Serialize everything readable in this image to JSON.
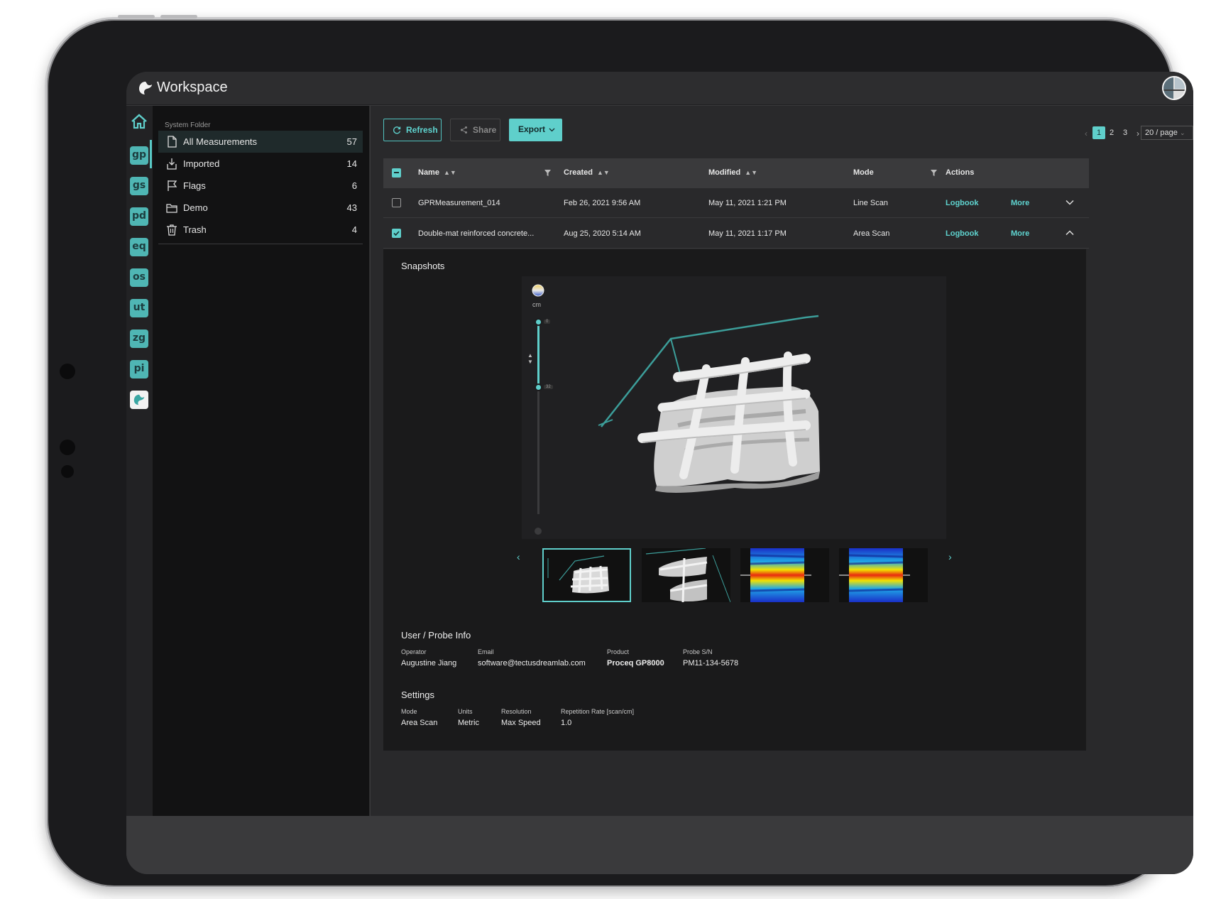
{
  "app": {
    "title": "Workspace"
  },
  "rail": {
    "apps": [
      {
        "id": "gp",
        "label": "gp"
      },
      {
        "id": "gs",
        "label": "gs"
      },
      {
        "id": "pd",
        "label": "pd"
      },
      {
        "id": "eq",
        "label": "eq"
      },
      {
        "id": "os",
        "label": "os"
      },
      {
        "id": "ut",
        "label": "ut"
      },
      {
        "id": "zg",
        "label": "zg"
      },
      {
        "id": "pi",
        "label": "pi"
      }
    ]
  },
  "folders": {
    "caption": "System Folder",
    "items": [
      {
        "label": "All Measurements",
        "count": "57",
        "icon": "document-icon",
        "active": true
      },
      {
        "label": "Imported",
        "count": "14",
        "icon": "import-icon"
      },
      {
        "label": "Flags",
        "count": "6",
        "icon": "flag-icon"
      },
      {
        "label": "Demo",
        "count": "43",
        "icon": "folder-icon"
      },
      {
        "label": "Trash",
        "count": "4",
        "icon": "trash-icon"
      }
    ]
  },
  "toolbar": {
    "refresh": "Refresh",
    "share": "Share",
    "export": "Export"
  },
  "pagination": {
    "pages": [
      "1",
      "2",
      "3"
    ],
    "current": "1",
    "page_size": "20 / page"
  },
  "table": {
    "columns": {
      "name": "Name",
      "created": "Created",
      "modified": "Modified",
      "mode": "Mode",
      "actions": "Actions"
    },
    "rows": [
      {
        "name": "GPRMeasurement_014",
        "created": "Feb 26, 2021 9:56 AM",
        "modified": "May 11, 2021 1:21 PM",
        "mode": "Line Scan",
        "logbook": "Logbook",
        "more": "More",
        "checked": false,
        "expanded": false
      },
      {
        "name": "Double-mat reinforced concrete...",
        "created": "Aug 25, 2020 5:14 AM",
        "modified": "May 11, 2021 1:17 PM",
        "mode": "Area Scan",
        "logbook": "Logbook",
        "more": "More",
        "checked": true,
        "expanded": true
      }
    ]
  },
  "detail": {
    "snapshots_title": "Snapshots",
    "viewer": {
      "unit": "cm",
      "slider_top_value": "0",
      "slider_bottom_value": "32"
    },
    "user_probe_title": "User / Probe Info",
    "operator_label": "Operator",
    "operator": "Augustine Jiang",
    "email_label": "Email",
    "email": "software@tectusdreamlab.com",
    "product_label": "Product",
    "product": "Proceq GP8000",
    "probe_label": "Probe S/N",
    "probe": "PM11-134-5678",
    "settings_title": "Settings",
    "mode_label": "Mode",
    "mode": "Area Scan",
    "units_label": "Units",
    "units": "Metric",
    "resolution_label": "Resolution",
    "resolution": "Max Speed",
    "rate_label": "Repetition Rate [scan/cm]",
    "rate": "1.0"
  },
  "colors": {
    "accent": "#5fcfcb",
    "background": "#29292b",
    "panel": "#121213"
  }
}
